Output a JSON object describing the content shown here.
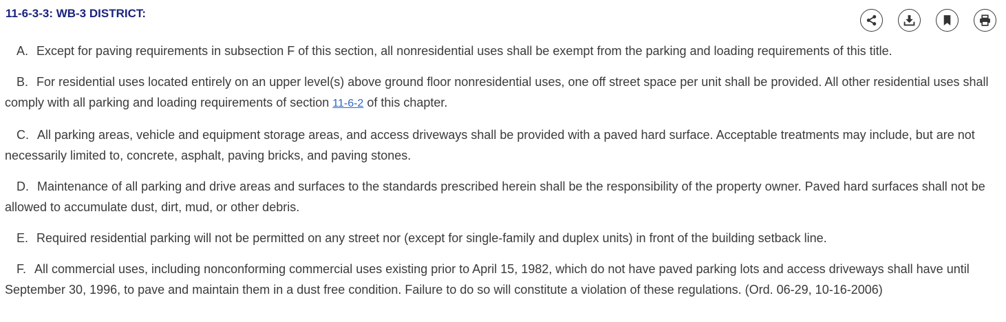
{
  "section": {
    "title": "11-6-3-3: WB-3 DISTRICT:"
  },
  "toolbar": {
    "share_icon": "share-icon",
    "download_icon": "download-icon",
    "bookmark_icon": "bookmark-icon",
    "print_icon": "print-icon"
  },
  "paragraphs": {
    "a": {
      "letter": "A.",
      "text": "Except for paving requirements in subsection F of this section, all nonresidential uses shall be exempt from the parking and loading requirements of this title."
    },
    "b": {
      "letter": "B.",
      "text_before": "For residential uses located entirely on an upper level(s) above ground floor nonresidential uses, one off street space per unit shall be provided. All other residential uses shall comply with all parking and loading requirements of section ",
      "link": "11-6-2",
      "text_after": " of this chapter."
    },
    "c": {
      "letter": "C.",
      "text": "All parking areas, vehicle and equipment storage areas, and access driveways shall be provided with a paved hard surface. Acceptable treatments may include, but are not necessarily limited to, concrete, asphalt, paving bricks, and paving stones."
    },
    "d": {
      "letter": "D.",
      "text": "Maintenance of all parking and drive areas and surfaces to the standards prescribed herein shall be the responsibility of the property owner. Paved hard surfaces shall not be allowed to accumulate dust, dirt, mud, or other debris."
    },
    "e": {
      "letter": "E.",
      "text": "Required residential parking will not be permitted on any street nor (except for single-family and duplex units) in front of the building setback line."
    },
    "f": {
      "letter": "F.",
      "text": "All commercial uses, including nonconforming commercial uses existing prior to April 15, 1982, which do not have paved parking lots and access driveways shall have until September 30, 1996, to pave and maintain them in a dust free condition. Failure to do so will constitute a violation of these regulations. (Ord. 06-29, 10-16-2006)"
    }
  }
}
